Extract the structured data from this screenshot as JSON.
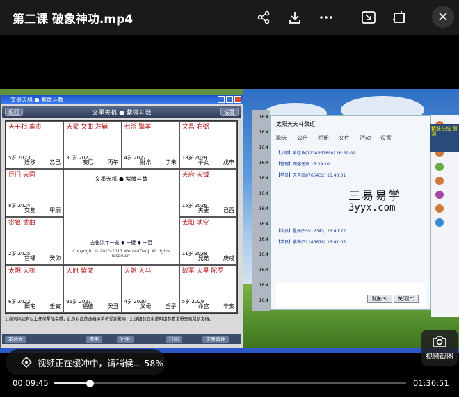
{
  "header": {
    "title": "第二课 破象神功.mp4",
    "icons": [
      "share-icon",
      "download-icon",
      "more-icon",
      "pip-icon",
      "fullscreen-icon",
      "close-icon"
    ]
  },
  "video": {
    "app_window": {
      "title": "文墨天机 ● 紫微斗数",
      "back_label": "返回",
      "settings_label": "设置",
      "center_line1": "文墨天机 ● 紫微斗数",
      "center_line2": "Copyright © 2010-2017 WenMoTianJi All rights reserved.",
      "center_line3": "吉化流年一览 ◆ 一键 ◆ 一百",
      "footnote": "1.命宫内如有以上任何星加会照，此命对应的命格运势将受到影响；2.详细的四化说明请参看文墨天机帮助文档。",
      "footer_buttons": [
        "本命盘",
        "流年",
        "行限",
        "打印",
        "文墨命理"
      ],
      "palaces": [
        {
          "stars": "天干相 廉贞",
          "age": "5岁 2023",
          "name": "迁移",
          "gz": "乙巳"
        },
        {
          "stars": "天梁 文曲 左辅",
          "age": "30岁 2027",
          "name": "疾厄",
          "gz": "丙午"
        },
        {
          "stars": "七杀 擎羊",
          "age": "4岁 2027",
          "name": "财帛",
          "gz": "丁未"
        },
        {
          "stars": "文昌 右弼",
          "age": "18岁 2028",
          "name": "子女",
          "gz": "戊申"
        },
        {
          "stars": "巨门 天同",
          "age": "8岁 2024",
          "name": "交友",
          "gz": "甲辰"
        },
        {
          "stars": "天府 天钺",
          "age": "15岁 2026",
          "name": "夫妻",
          "gz": "己酉"
        },
        {
          "stars": "贪狼 武曲",
          "age": "2岁 2025",
          "name": "官禄",
          "gz": "癸卯"
        },
        {
          "stars": "太阳 地空",
          "age": "11岁 2028",
          "name": "兄弟",
          "gz": "庚戌"
        },
        {
          "stars": "太阴 天机",
          "age": "6岁 2022",
          "name": "田宅",
          "gz": "壬寅"
        },
        {
          "stars": "天府 紫微",
          "age": "91岁 2021",
          "name": "福德",
          "gz": "癸丑"
        },
        {
          "stars": "天魁 天马",
          "age": "4岁 2020",
          "name": "父母",
          "gz": "壬子"
        },
        {
          "stars": "破军 火星 陀罗",
          "age": "5岁 2029",
          "name": "命宫",
          "gz": "辛亥"
        }
      ]
    },
    "chat_window": {
      "title": "太阳天天斗数班",
      "tabs": [
        "聊天",
        "公告",
        "相册",
        "文件",
        "活动",
        "设置"
      ],
      "watermark_line1": "三易易学",
      "watermark_line2": "3yyx.com",
      "lines": [
        "【大咖】爱吃鱼(1234567890)  16:39:02",
        "【管理】雨落无声 16:39:10",
        "【学员】天天(98765432) 16:40:01",
        "【学员】星辰(55512345) 16:40:22",
        "【学员】紫薇(32145678) 16:41:05"
      ],
      "send_label": "发送(S)",
      "close_label": "关闭(C)",
      "banner": "精准在线 测测"
    }
  },
  "overlay": {
    "buffer_text": "视频正在缓冲中，请稍候... 58%",
    "buffer_percent": 58,
    "snapshot_label": "视频截图"
  },
  "playback": {
    "current_time": "00:09:45",
    "total_time": "01:36:51",
    "played_fraction": 0.1007,
    "buffered_fraction": 0.11
  }
}
